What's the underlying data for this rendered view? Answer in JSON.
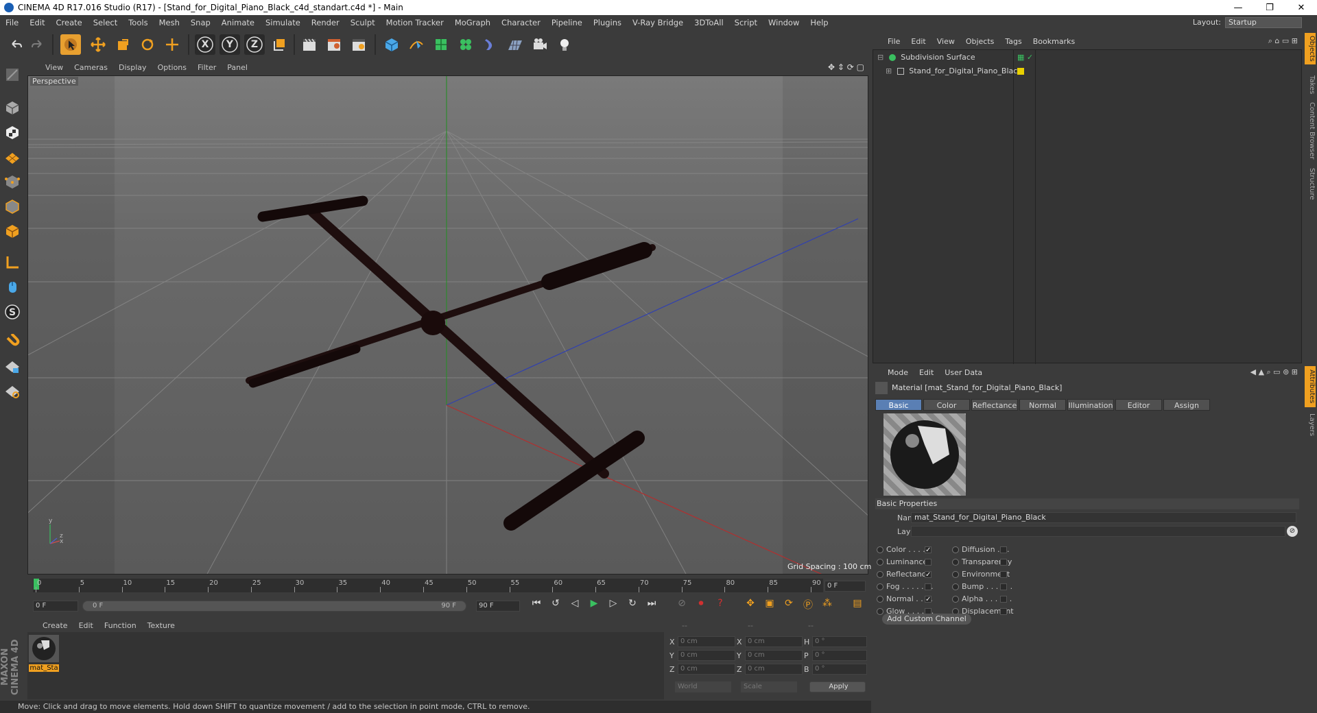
{
  "window": {
    "title": "CINEMA 4D R17.016 Studio (R17) - [Stand_for_Digital_Piano_Black_c4d_standart.c4d *] - Main",
    "minimize": "—",
    "restore": "❐",
    "close": "✕"
  },
  "menubar": {
    "items": [
      "File",
      "Edit",
      "Create",
      "Select",
      "Tools",
      "Mesh",
      "Snap",
      "Animate",
      "Simulate",
      "Render",
      "Sculpt",
      "Motion Tracker",
      "MoGraph",
      "Character",
      "Pipeline",
      "Plugins",
      "V-Ray Bridge",
      "3DToAll",
      "Script",
      "Window",
      "Help"
    ],
    "layout_label": "Layout:",
    "layout_value": "Startup"
  },
  "toolbar": {
    "axis_x": "X",
    "axis_y": "Y",
    "axis_z": "Z"
  },
  "viewport": {
    "menu": [
      "View",
      "Cameras",
      "Display",
      "Options",
      "Filter",
      "Panel"
    ],
    "label": "Perspective",
    "grid_spacing": "Grid Spacing : 100 cm",
    "axis_y": "y",
    "axis_z": "z",
    "axis_x": "x"
  },
  "timeline": {
    "ticks": [
      "0",
      "5",
      "10",
      "15",
      "20",
      "25",
      "30",
      "35",
      "40",
      "45",
      "50",
      "55",
      "60",
      "65",
      "70",
      "75",
      "80",
      "85",
      "90"
    ],
    "current_frame": "0 F",
    "start_field": "0 F",
    "range_start": "0 F",
    "range_end": "90 F",
    "end_field": "90 F"
  },
  "material_manager": {
    "menu": [
      "Create",
      "Edit",
      "Function",
      "Texture"
    ],
    "material_label": "mat_Sta"
  },
  "coordinates": {
    "header": [
      "--",
      "--",
      "--"
    ],
    "rows": [
      {
        "a": "X",
        "av": "0 cm",
        "b": "X",
        "bv": "0 cm",
        "c": "H",
        "cv": "0 °"
      },
      {
        "a": "Y",
        "av": "0 cm",
        "b": "Y",
        "bv": "0 cm",
        "c": "P",
        "cv": "0 °"
      },
      {
        "a": "Z",
        "av": "0 cm",
        "b": "Z",
        "bv": "0 cm",
        "c": "B",
        "cv": "0 °"
      }
    ],
    "world": "World",
    "scale": "Scale",
    "apply": "Apply"
  },
  "status": {
    "text": "Move: Click and drag to move elements. Hold down SHIFT to quantize movement / add to the selection in point mode, CTRL to remove."
  },
  "object_manager": {
    "menu": [
      "File",
      "Edit",
      "View",
      "Objects",
      "Tags",
      "Bookmarks"
    ],
    "objects": [
      "Subdivision Surface",
      "Stand_for_Digital_Piano_Black"
    ]
  },
  "attributes": {
    "menu": [
      "Mode",
      "Edit",
      "User Data"
    ],
    "title": "Material [mat_Stand_for_Digital_Piano_Black]",
    "tabs": [
      "Basic",
      "Color",
      "Reflectance",
      "Normal",
      "Illumination",
      "Editor",
      "Assign"
    ],
    "section": "Basic Properties",
    "name_label": "Name",
    "name_value": "mat_Stand_for_Digital_Piano_Black",
    "layer_label": "Layer",
    "channels_left": [
      {
        "label": "Color . . . . .",
        "checked": true
      },
      {
        "label": "Luminance",
        "checked": false
      },
      {
        "label": "Reflectance",
        "checked": true
      },
      {
        "label": "Fog . . . . . . .",
        "checked": false
      },
      {
        "label": "Normal . . . .",
        "checked": true
      },
      {
        "label": "Glow . . . . . .",
        "checked": false
      }
    ],
    "channels_right": [
      {
        "label": "Diffusion . . .",
        "checked": false
      },
      {
        "label": "Transparency",
        "checked": false
      },
      {
        "label": "Environment",
        "checked": false
      },
      {
        "label": "Bump . . . . . .",
        "checked": false
      },
      {
        "label": "Alpha . . . . . .",
        "checked": false
      },
      {
        "label": "Displacement",
        "checked": false
      }
    ],
    "add_channel": "Add Custom Channel"
  },
  "side_tabs": [
    "Objects",
    "Takes",
    "Content Browser",
    "Structure",
    "Attributes",
    "Layers"
  ],
  "branding": "MAXON CINEMA 4D",
  "colors": {
    "accent": "#5a7fb4",
    "active_orange": "#e8a030",
    "stand_color": "#2a1414"
  }
}
